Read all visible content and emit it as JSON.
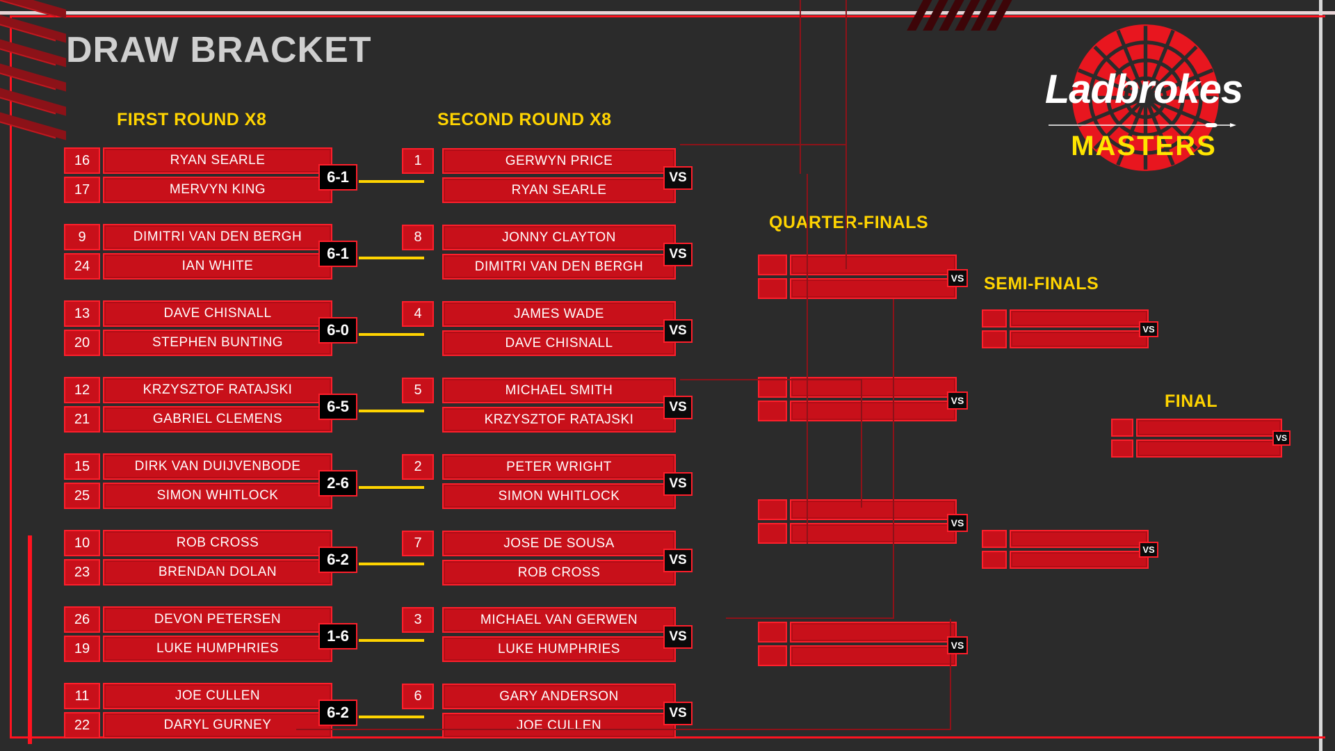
{
  "page": {
    "title": "DRAW BRACKET",
    "accent_red": "#ff1320",
    "accent_yellow": "#ffd400",
    "background": "#2b2b2b"
  },
  "logo": {
    "brand": "Ladbrokes",
    "event": "MASTERS",
    "dartboard_icon": "dartboard-icon",
    "dart_icon": "dart-arrow-icon"
  },
  "rounds": {
    "first": "FIRST ROUND X8",
    "second": "SECOND ROUND X8",
    "quarter": "QUARTER-FINALS",
    "semi": "SEMI-FINALS",
    "final": "FINAL"
  },
  "vs_label": "VS",
  "first_round": [
    {
      "top_seed": "16",
      "top_name": "RYAN SEARLE",
      "bottom_seed": "17",
      "bottom_name": "MERVYN KING",
      "score": "6-1"
    },
    {
      "top_seed": "9",
      "top_name": "DIMITRI VAN DEN BERGH",
      "bottom_seed": "24",
      "bottom_name": "IAN WHITE",
      "score": "6-1"
    },
    {
      "top_seed": "13",
      "top_name": "DAVE CHISNALL",
      "bottom_seed": "20",
      "bottom_name": "STEPHEN BUNTING",
      "score": "6-0"
    },
    {
      "top_seed": "12",
      "top_name": "KRZYSZTOF RATAJSKI",
      "bottom_seed": "21",
      "bottom_name": "GABRIEL CLEMENS",
      "score": "6-5"
    },
    {
      "top_seed": "15",
      "top_name": "DIRK VAN DUIJVENBODE",
      "bottom_seed": "25",
      "bottom_name": "SIMON WHITLOCK",
      "score": "2-6"
    },
    {
      "top_seed": "10",
      "top_name": "ROB CROSS",
      "bottom_seed": "23",
      "bottom_name": "BRENDAN DOLAN",
      "score": "6-2"
    },
    {
      "top_seed": "26",
      "top_name": "DEVON PETERSEN",
      "bottom_seed": "19",
      "bottom_name": "LUKE HUMPHRIES",
      "score": "1-6"
    },
    {
      "top_seed": "11",
      "top_name": "JOE CULLEN",
      "bottom_seed": "22",
      "bottom_name": "DARYL GURNEY",
      "score": "6-2"
    }
  ],
  "second_round": [
    {
      "seed": "1",
      "top_name": "GERWYN PRICE",
      "bottom_name": "RYAN SEARLE"
    },
    {
      "seed": "8",
      "top_name": "JONNY CLAYTON",
      "bottom_name": "DIMITRI VAN DEN BERGH"
    },
    {
      "seed": "4",
      "top_name": "JAMES WADE",
      "bottom_name": "DAVE CHISNALL"
    },
    {
      "seed": "5",
      "top_name": "MICHAEL SMITH",
      "bottom_name": "KRZYSZTOF RATAJSKI"
    },
    {
      "seed": "2",
      "top_name": "PETER WRIGHT",
      "bottom_name": "SIMON WHITLOCK"
    },
    {
      "seed": "7",
      "top_name": "JOSE DE SOUSA",
      "bottom_name": "ROB CROSS"
    },
    {
      "seed": "3",
      "top_name": "MICHAEL VAN GERWEN",
      "bottom_name": "LUKE HUMPHRIES"
    },
    {
      "seed": "6",
      "top_name": "GARY ANDERSON",
      "bottom_name": "JOE CULLEN"
    }
  ],
  "quarter_finals": [
    {
      "top_seed": "",
      "top_name": "",
      "bottom_seed": "",
      "bottom_name": ""
    },
    {
      "top_seed": "",
      "top_name": "",
      "bottom_seed": "",
      "bottom_name": ""
    },
    {
      "top_seed": "",
      "top_name": "",
      "bottom_seed": "",
      "bottom_name": ""
    },
    {
      "top_seed": "",
      "top_name": "",
      "bottom_seed": "",
      "bottom_name": ""
    }
  ],
  "semi_finals": [
    {
      "top_seed": "",
      "top_name": "",
      "bottom_seed": "",
      "bottom_name": ""
    },
    {
      "top_seed": "",
      "top_name": "",
      "bottom_seed": "",
      "bottom_name": ""
    }
  ],
  "final": [
    {
      "top_seed": "",
      "top_name": "",
      "bottom_seed": "",
      "bottom_name": ""
    }
  ]
}
